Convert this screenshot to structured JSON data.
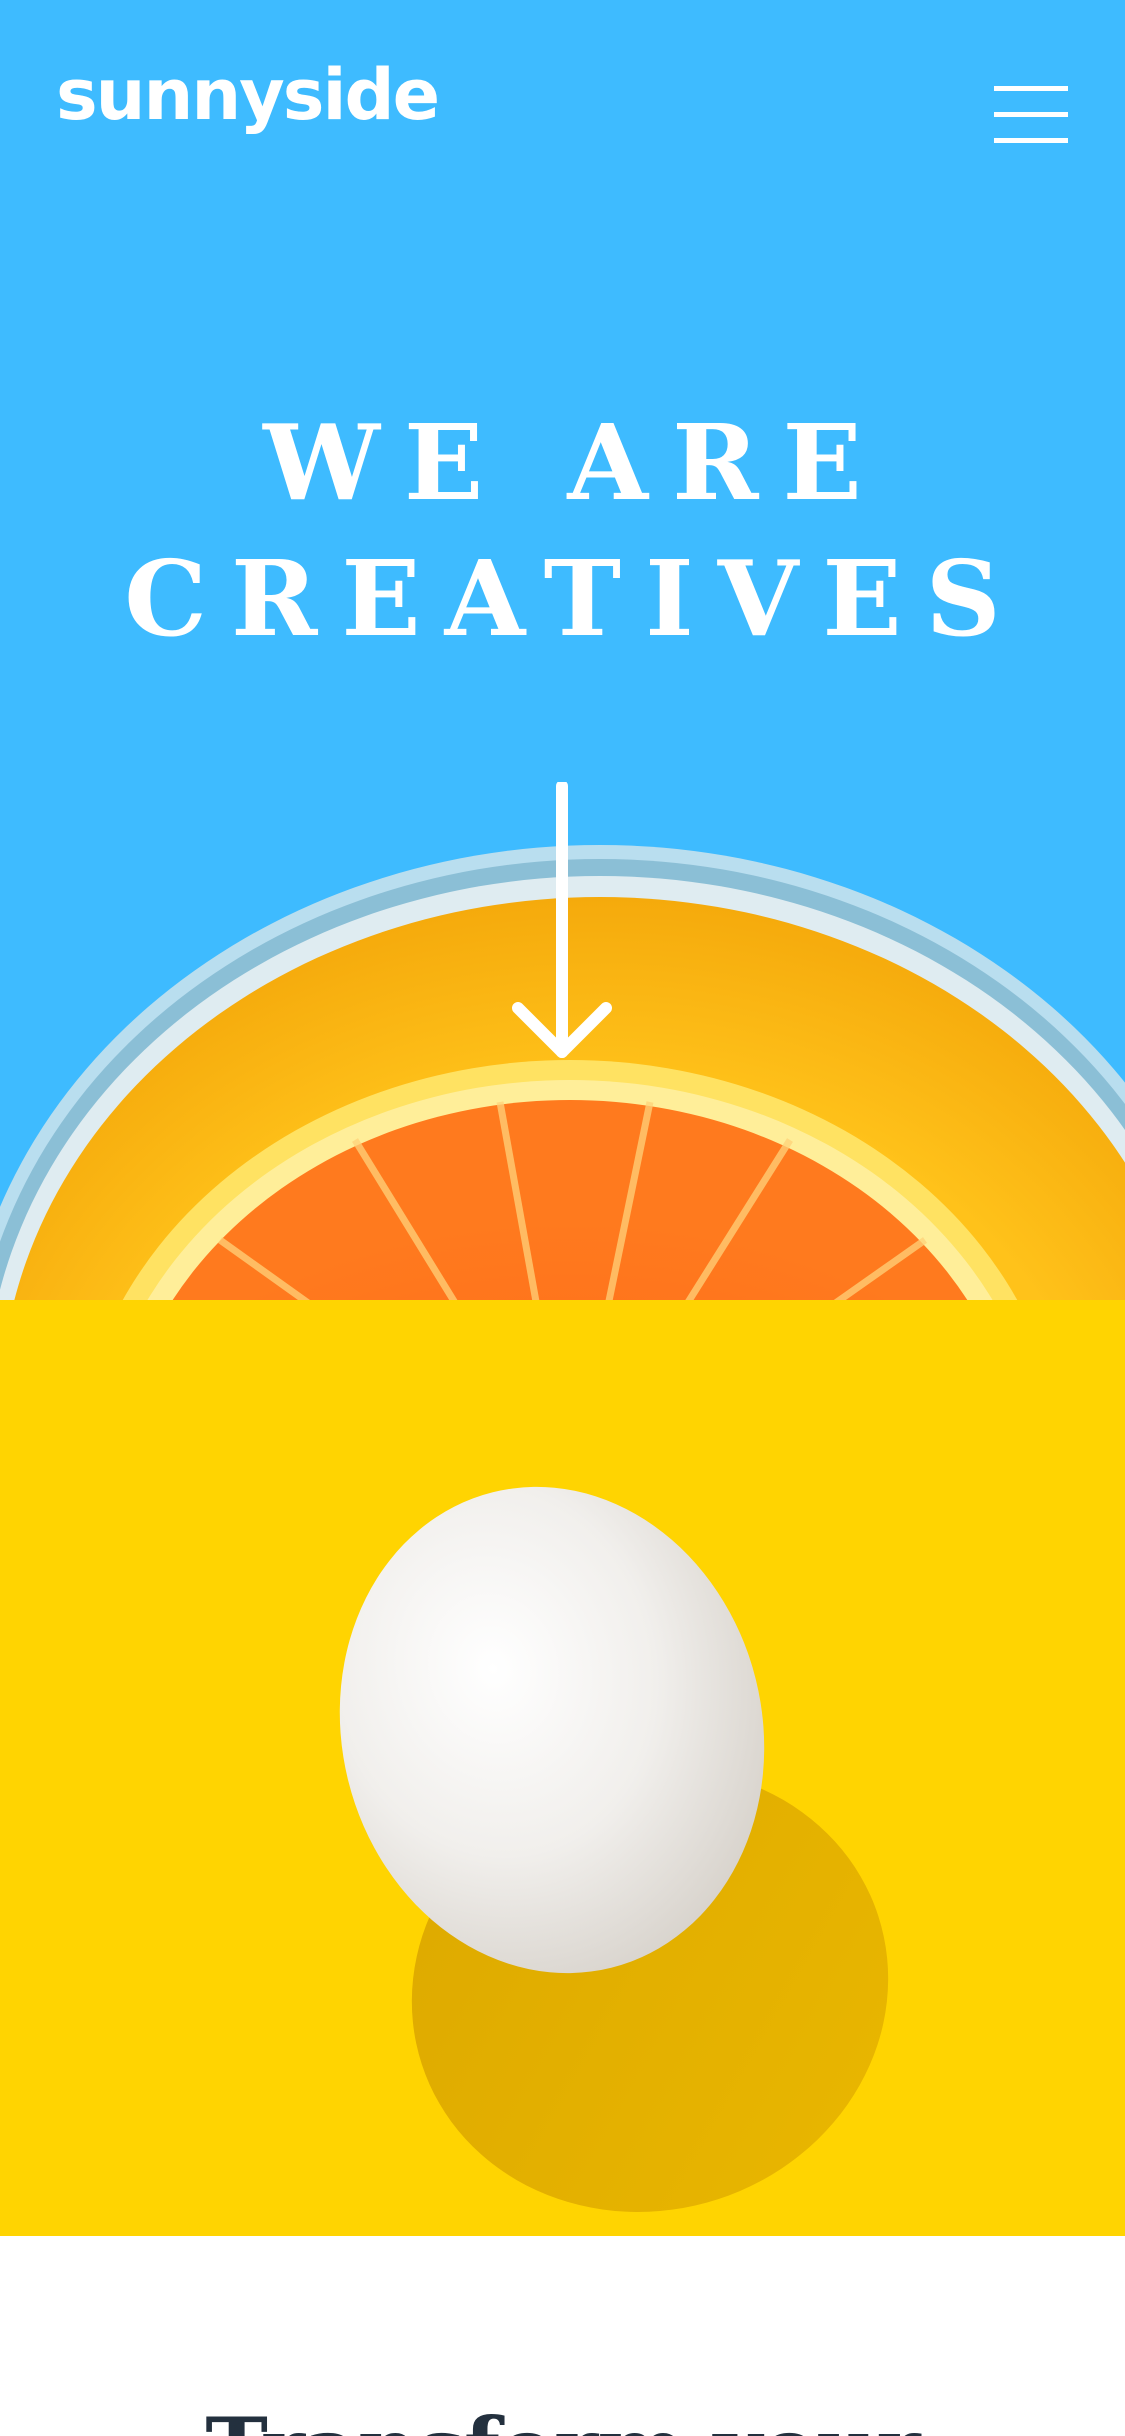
{
  "header": {
    "logo": "sunnyside",
    "menu_icon": "hamburger-menu-icon"
  },
  "hero": {
    "title_line1": "WE ARE",
    "title_line2": "CREATIVES",
    "arrow_icon": "arrow-down-icon",
    "image": "orange-slice-in-glass"
  },
  "egg_section": {
    "image": "white-egg-on-yellow"
  },
  "transform": {
    "heading": "Transform your"
  },
  "colors": {
    "hero_bg": "#3EBBFF",
    "egg_bg": "#FFD401",
    "heading_text": "#23303E",
    "white": "#FFFFFF"
  }
}
